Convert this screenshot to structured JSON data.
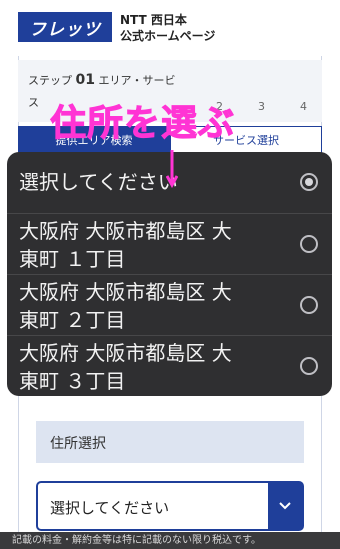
{
  "header": {
    "logo_text": "フレッツ",
    "brand_line1": "NTT 西日本",
    "brand_line2": "公式ホームページ"
  },
  "steps": {
    "step_prefix": "ステップ",
    "step_number": "01",
    "step_title": "エリア・サービ",
    "step_title_cont": "ス",
    "step_others": [
      "2",
      "3",
      "4"
    ],
    "tabs": [
      "提供エリア検索",
      "サービス選択"
    ]
  },
  "annotation": {
    "title": "住所を選ぶ",
    "color": "#ff34d4"
  },
  "picker": {
    "options": [
      {
        "line1": "選択してください",
        "line2": "",
        "selected": true
      },
      {
        "line1": "大阪府 大阪市都島区 大",
        "line2": "東町 １丁目",
        "selected": false
      },
      {
        "line1": "大阪府 大阪市都島区 大",
        "line2": "東町 ２丁目",
        "selected": false
      },
      {
        "line1": "大阪府 大阪市都島区 大",
        "line2": "東町 ３丁目",
        "selected": false
      }
    ]
  },
  "form": {
    "address_label": "住所選択",
    "select_value": "選択してください"
  },
  "footer": {
    "note": "記載の料金・解約金等は特に記載のない限り税込です。"
  },
  "colors": {
    "brand_blue": "#1f3f9a",
    "picker_bg": "#2f2f31"
  }
}
